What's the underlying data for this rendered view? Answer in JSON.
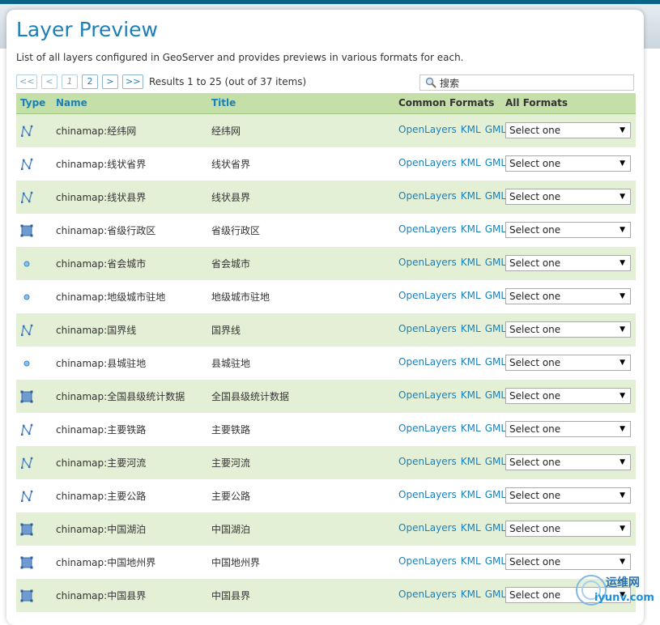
{
  "page": {
    "title": "Layer Preview",
    "description": "List of all layers configured in GeoServer and provides previews in various formats for each."
  },
  "pager": {
    "first": "<<",
    "prev": "<",
    "page1": "1",
    "page2": "2",
    "next": ">",
    "last": ">>",
    "results": "Results 1 to 25 (out of 37 items)"
  },
  "search": {
    "value": "搜索"
  },
  "table": {
    "headers": {
      "type": "Type",
      "name": "Name",
      "title": "Title",
      "common": "Common Formats",
      "all": "All Formats"
    },
    "formats": [
      "OpenLayers",
      "KML",
      "GML"
    ],
    "select_label": "Select one",
    "rows": [
      {
        "type": "line",
        "name": "chinamap:经纬网",
        "title": "经纬网"
      },
      {
        "type": "line",
        "name": "chinamap:线状省界",
        "title": "线状省界"
      },
      {
        "type": "line",
        "name": "chinamap:线状县界",
        "title": "线状县界"
      },
      {
        "type": "polygon",
        "name": "chinamap:省级行政区",
        "title": "省级行政区"
      },
      {
        "type": "point",
        "name": "chinamap:省会城市",
        "title": "省会城市"
      },
      {
        "type": "point",
        "name": "chinamap:地级城市驻地",
        "title": "地级城市驻地"
      },
      {
        "type": "line",
        "name": "chinamap:国界线",
        "title": "国界线"
      },
      {
        "type": "point",
        "name": "chinamap:县城驻地",
        "title": "县城驻地"
      },
      {
        "type": "polygon",
        "name": "chinamap:全国县级统计数据",
        "title": "全国县级统计数据"
      },
      {
        "type": "line",
        "name": "chinamap:主要铁路",
        "title": "主要铁路"
      },
      {
        "type": "line",
        "name": "chinamap:主要河流",
        "title": "主要河流"
      },
      {
        "type": "line",
        "name": "chinamap:主要公路",
        "title": "主要公路"
      },
      {
        "type": "polygon",
        "name": "chinamap:中国湖泊",
        "title": "中国湖泊"
      },
      {
        "type": "polygon",
        "name": "chinamap:中国地州界",
        "title": "中国地州界"
      },
      {
        "type": "polygon",
        "name": "chinamap:中国县界",
        "title": "中国县界"
      }
    ]
  },
  "watermark": {
    "line1": "运维网",
    "line2": "iyunv.com"
  },
  "colors": {
    "accent": "#1c7fb8",
    "header_bg": "#c4dfa8",
    "row_alt": "#e4f0d5"
  }
}
